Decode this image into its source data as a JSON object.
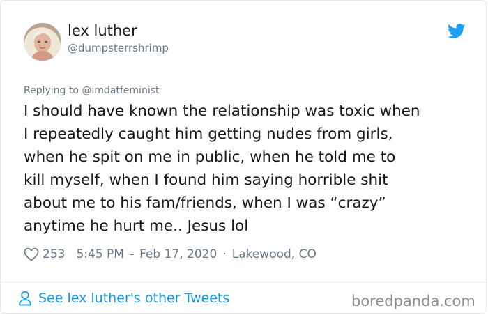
{
  "user": {
    "display_name": "lex luther",
    "handle": "@dumpsterrshrimp"
  },
  "icons": {
    "platform": "twitter-bird-icon",
    "like": "heart-outline-icon",
    "profile": "person-outline-icon"
  },
  "colors": {
    "accent": "#1da1f2",
    "link": "#1b95e0",
    "secondary_text": "#657786",
    "primary_text": "#14171a"
  },
  "tweet": {
    "reply_prefix": "Replying to",
    "reply_to": "@imdatfeminist",
    "lines": [
      "I should have known the relationship was toxic when",
      "I repeatedly caught him getting nudes from girls,",
      "when he spit on me in public, when he told me to",
      "kill myself, when I found him saying horrible shit",
      "about me to his fam/friends, when I was “crazy”",
      "anytime he hurt me.. Jesus lol"
    ],
    "likes": "253",
    "time": "5:45 PM",
    "date": "Feb 17, 2020",
    "location": "Lakewood, CO"
  },
  "footer": {
    "link_label": "See lex luther's other Tweets",
    "watermark": "boredpanda.com"
  }
}
